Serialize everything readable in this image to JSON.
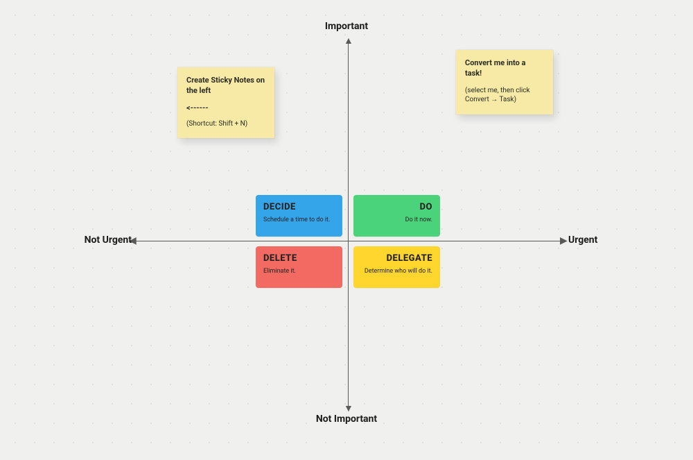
{
  "axis": {
    "top": "Important",
    "bottom": "Not Important",
    "left": "Not Urgent",
    "right": "Urgent"
  },
  "quadrants": {
    "decide": {
      "title": "DECIDE",
      "sub": "Schedule a time to do it.",
      "color": "#35a5ea"
    },
    "do": {
      "title": "DO",
      "sub": "Do it now.",
      "color": "#4bd37b"
    },
    "delete": {
      "title": "DELETE",
      "sub": "Eliminate it.",
      "color": "#f26a62"
    },
    "delegate": {
      "title": "DELEGATE",
      "sub": "Determine who will do it.",
      "color": "#ffd62e"
    }
  },
  "sticky_left": {
    "title": "Create Sticky Notes on the left",
    "arrow": "<------",
    "sub": "(Shortcut: Shift + N)"
  },
  "sticky_right": {
    "title": "Convert me into a task!",
    "sub": "(select me, then click Convert → Task)"
  }
}
